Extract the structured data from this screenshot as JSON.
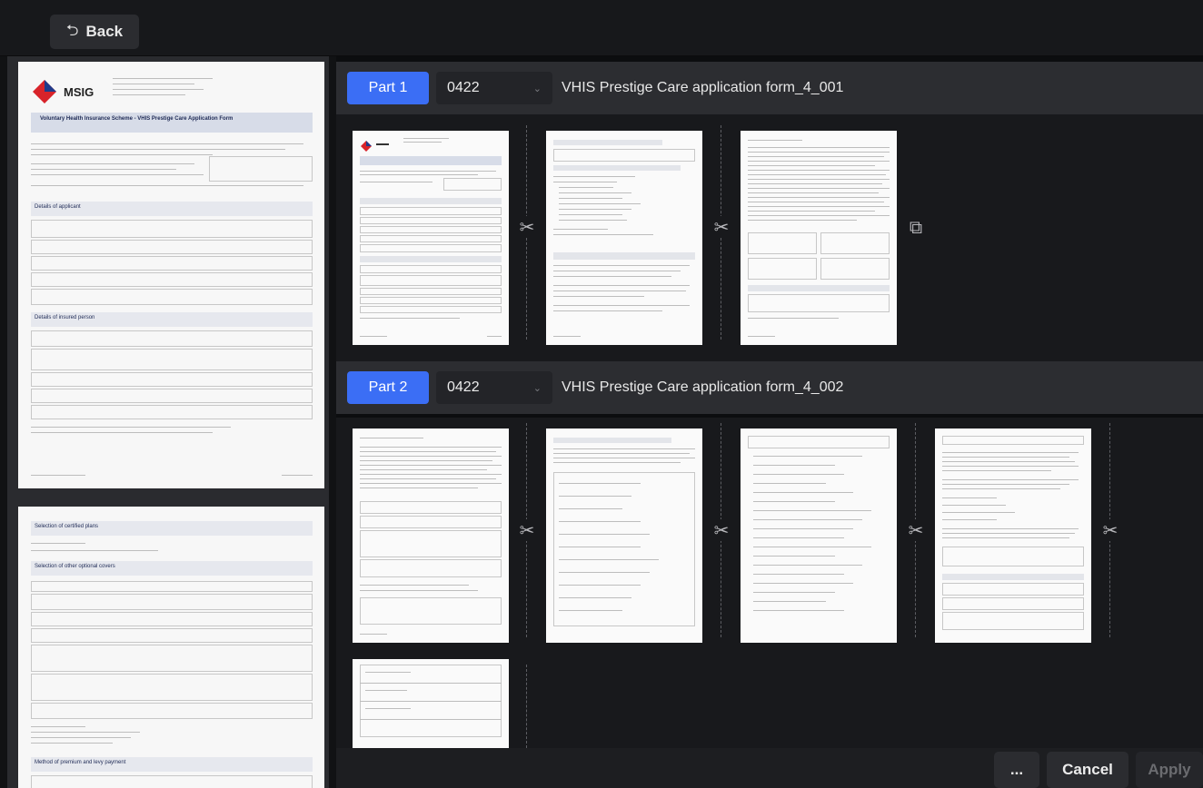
{
  "topbar": {
    "back_label": "Back",
    "back_icon": "undo-arrow-icon"
  },
  "preview": {
    "page1": {
      "brand": "MSIG",
      "title": "Voluntary Health Insurance Scheme - VHIS Prestige Care Application Form",
      "section1": "Details of applicant",
      "section2": "Details of insured person"
    },
    "page2": {
      "section1": "Selection of certified plans",
      "section2": "Selection of other optional covers",
      "section3": "Method of premium and levy payment"
    }
  },
  "parts": [
    {
      "label": "Part 1",
      "code": "0422",
      "filename": "VHIS Prestige Care application form_4_001",
      "page_count": 3
    },
    {
      "label": "Part 2",
      "code": "0422",
      "filename": "VHIS Prestige Care application form_4_002",
      "page_count": 5
    }
  ],
  "footer": {
    "more_label": "...",
    "cancel_label": "Cancel",
    "apply_label": "Apply"
  },
  "colors": {
    "accent": "#3b6ef5",
    "background": "#111214",
    "panel": "#2c2d31"
  }
}
